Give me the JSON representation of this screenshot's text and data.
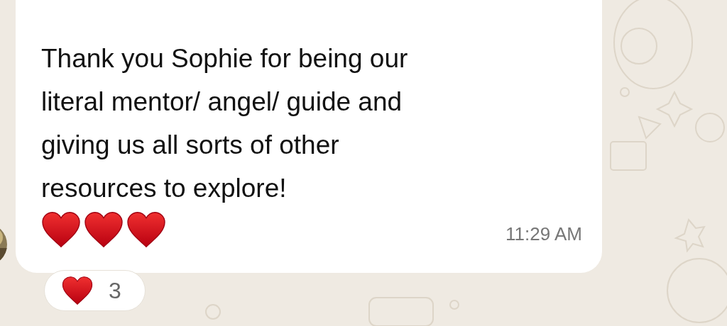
{
  "message": {
    "text": "Thank you Sophie for being our\nliteral mentor/ angel/ guide and\ngiving us all sorts of other\nresources to explore!",
    "time": "11:29 AM"
  },
  "reaction": {
    "count": "3"
  }
}
